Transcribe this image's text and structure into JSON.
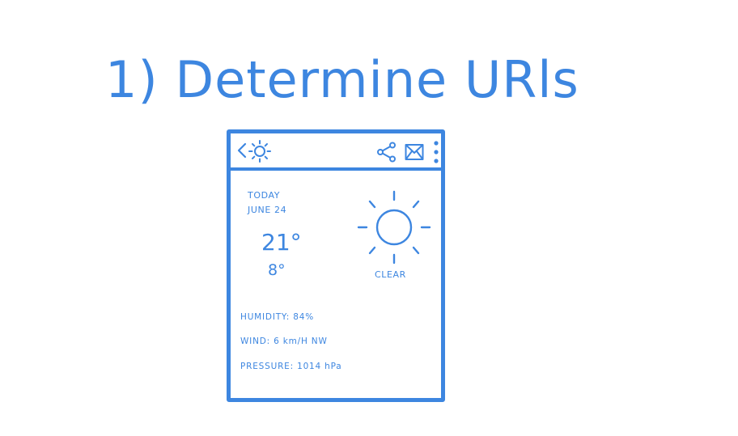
{
  "heading": "1) Determine URls",
  "app_bar": {
    "icons": [
      "back-arrow-icon",
      "sun-logo-icon",
      "share-icon",
      "map-icon",
      "overflow-menu-icon"
    ]
  },
  "forecast": {
    "day": "TODAY",
    "date": "JUNE 24",
    "high": "21°",
    "low": "8°",
    "condition": "CLEAR",
    "condition_icon": "sun-icon"
  },
  "details": {
    "humidity": "HUMIDITY: 84%",
    "wind": "WIND: 6 km/H NW",
    "pressure": "PRESSURE: 1014 hPa"
  },
  "colors": {
    "ink": "#3d86e0",
    "background": "#ffffff"
  }
}
